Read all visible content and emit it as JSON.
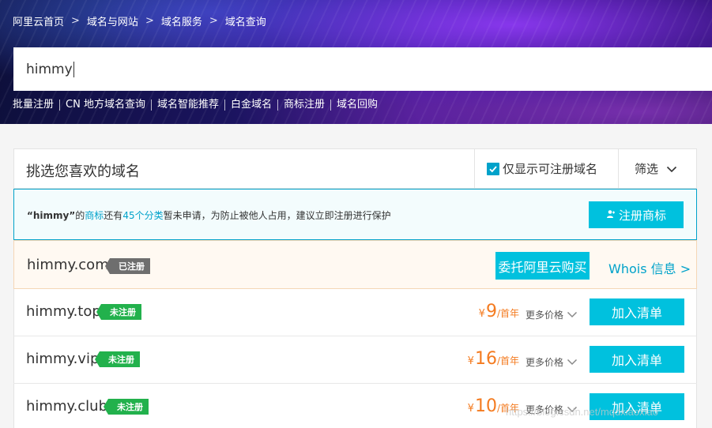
{
  "breadcrumb": [
    "阿里云首页",
    "域名与网站",
    "域名服务",
    "域名查询"
  ],
  "breadcrumb_sep": ">",
  "search": {
    "value": "himmy"
  },
  "quicklinks": [
    "批量注册",
    "CN 地方域名查询",
    "域名智能推荐",
    "白金域名",
    "商标注册",
    "域名回购"
  ],
  "panel": {
    "title": "挑选您喜欢的域名",
    "filter_checkbox_label": "仅显示可注册域名",
    "filter_menu_label": "筛选"
  },
  "trademark": {
    "name_quoted": "“himmy”",
    "t1": "的",
    "link1": "商标",
    "t2": "还有",
    "link2": "45个分类",
    "t3": "暂未申请，为防止被他人占用，建议立即注册进行保护",
    "button_label": "注册商标"
  },
  "results": [
    {
      "domain": "himmy.com",
      "status": "已注册",
      "action": "委托阿里云购买",
      "whois": "Whois 信息 >"
    },
    {
      "domain": "himmy.top",
      "status": "未注册",
      "currency": "¥",
      "price": "9",
      "unit": "/首年",
      "more": "更多价格",
      "action": "加入清单"
    },
    {
      "domain": "himmy.vip",
      "status": "未注册",
      "currency": "¥",
      "price": "16",
      "unit": "/首年",
      "more": "更多价格",
      "action": "加入清单"
    },
    {
      "domain": "himmy.club",
      "status": "未注册",
      "currency": "¥",
      "price": "10",
      "unit": "/首年",
      "more": "更多价格",
      "action": "加入清单"
    }
  ],
  "watermark": "https://blog.csdn.net/mqdxiaoxiao",
  "colors": {
    "accent": "#00c1de",
    "link": "#00a2ca",
    "price": "#f47b20",
    "registered": "#6e6e6e",
    "available": "#22b14c"
  }
}
